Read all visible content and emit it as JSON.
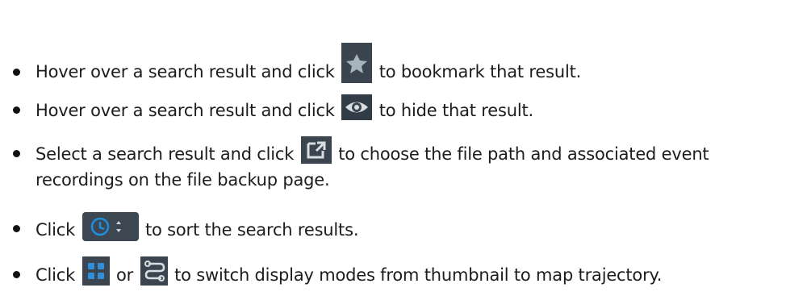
{
  "items": [
    {
      "before": "Hover over a search result and click",
      "icon": "star-icon",
      "after": "to bookmark that result."
    },
    {
      "before": "Hover over a search result and click",
      "icon": "eye-icon",
      "after": "to hide that result."
    },
    {
      "before": "Select a search result and click",
      "icon": "export-icon",
      "after": "to choose the file path and associated event",
      "line2": "recordings on the file backup page."
    },
    {
      "before": "Click",
      "icon": "clock-sort-icon",
      "after": "to sort the search results."
    },
    {
      "before": "Click",
      "icon": "thumbnail-grid-icon",
      "middle": "or",
      "icon2": "map-trajectory-icon",
      "after": "to switch display modes from thumbnail to map trajectory."
    }
  ],
  "colors": {
    "text": "#1c1c1c",
    "icon_background": "#37404a",
    "accent_blue": "#2a77b8"
  }
}
